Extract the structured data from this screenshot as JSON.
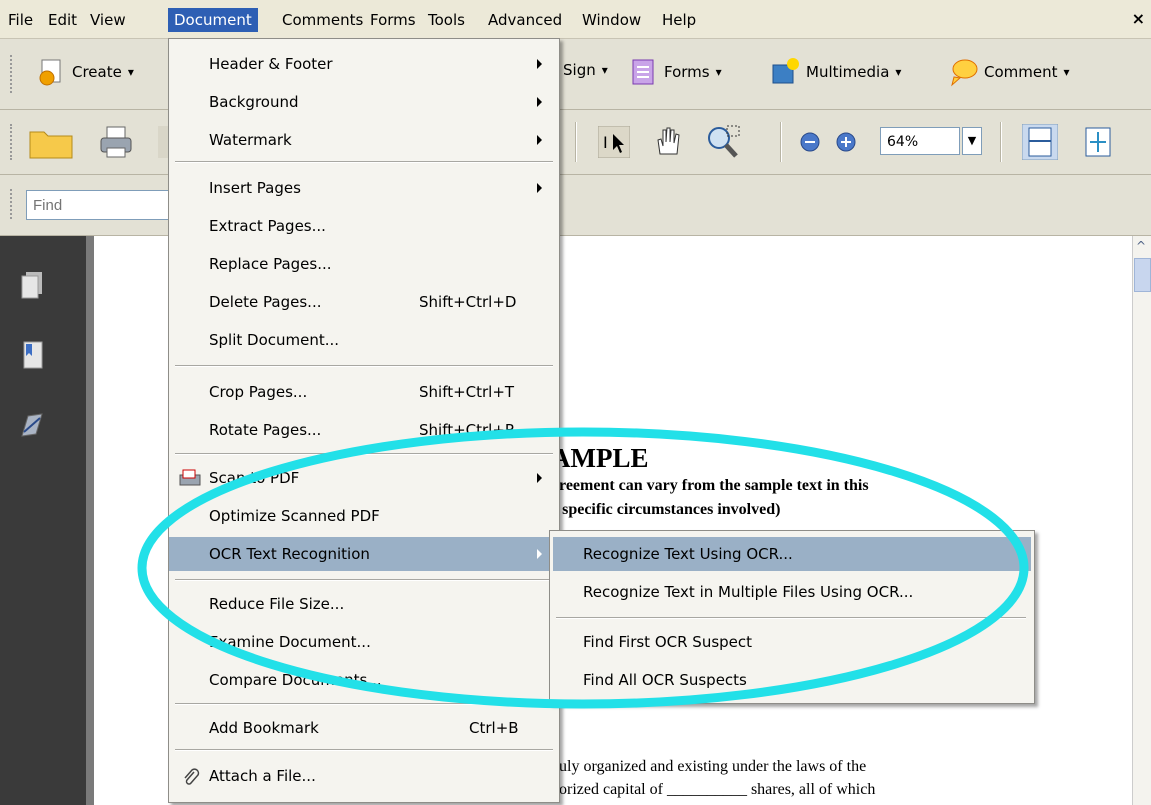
{
  "menubar": {
    "items": [
      "File",
      "Edit",
      "View",
      "Document",
      "Comments",
      "Forms",
      "Tools",
      "Advanced",
      "Window",
      "Help"
    ],
    "close_glyph": "×"
  },
  "toolbar1": {
    "create_label": "Create",
    "sign_label": "Sign",
    "forms_label": "Forms",
    "multimedia_label": "Multimedia",
    "comment_label": "Comment",
    "dropdown_glyph": "▾"
  },
  "toolbar2": {
    "zoom_value": "64%"
  },
  "findbar": {
    "find_placeholder": "Find"
  },
  "document_menu": {
    "items": [
      {
        "label": "Header & Footer",
        "shortcut": "",
        "submenu": true
      },
      {
        "label": "Background",
        "shortcut": "",
        "submenu": true
      },
      {
        "label": "Watermark",
        "shortcut": "",
        "submenu": true
      },
      {
        "label": "Insert Pages",
        "shortcut": "",
        "submenu": true
      },
      {
        "label": "Extract Pages...",
        "shortcut": "",
        "submenu": false
      },
      {
        "label": "Replace Pages...",
        "shortcut": "",
        "submenu": false
      },
      {
        "label": "Delete Pages...",
        "shortcut": "Shift+Ctrl+D",
        "submenu": false
      },
      {
        "label": "Split Document...",
        "shortcut": "",
        "submenu": false
      },
      {
        "label": "Crop Pages...",
        "shortcut": "Shift+Ctrl+T",
        "submenu": false
      },
      {
        "label": "Rotate Pages...",
        "shortcut": "Shift+Ctrl+R",
        "submenu": false
      },
      {
        "label": "Scan to PDF",
        "shortcut": "",
        "submenu": true
      },
      {
        "label": "Optimize Scanned PDF",
        "shortcut": "",
        "submenu": false
      },
      {
        "label": "OCR Text Recognition",
        "shortcut": "",
        "submenu": true
      },
      {
        "label": "Reduce File Size...",
        "shortcut": "",
        "submenu": false
      },
      {
        "label": "Examine Document...",
        "shortcut": "",
        "submenu": false
      },
      {
        "label": "Compare Documents...",
        "shortcut": "",
        "submenu": false
      },
      {
        "label": "Add Bookmark",
        "shortcut": "Ctrl+B",
        "submenu": false
      },
      {
        "label": "Attach a File...",
        "shortcut": "",
        "submenu": false
      }
    ]
  },
  "ocr_submenu": {
    "items": [
      {
        "label": "Recognize Text Using OCR..."
      },
      {
        "label": "Recognize Text in Multiple Files Using OCR..."
      },
      {
        "label": "Find First OCR Suspect"
      },
      {
        "label": "Find All OCR Suspects"
      }
    ]
  },
  "document": {
    "heading": "AMPLE",
    "line1": "greement can vary from the sample text in this",
    "line2": "e specific circumstances involved)",
    "line3": "duly organized and existing under the laws of the",
    "line4": "horized capital of __________ shares, all of which"
  },
  "colors": {
    "menu_highlight": "#9ab0c6",
    "menubar_active": "#2e5fb4",
    "annotation_ellipse": "#22e0e8"
  }
}
